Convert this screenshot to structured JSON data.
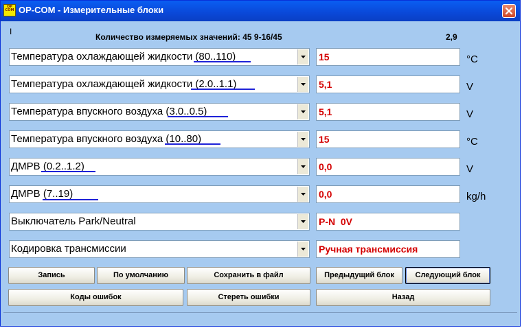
{
  "window": {
    "title": "OP-COM - Измерительные блоки",
    "icon_text": "OP COM",
    "icon_name": "opcom-app-icon",
    "close_icon": "close-icon"
  },
  "header": {
    "cursor_mark": "I",
    "count_text": "Количество измеряемых значений: 45   9-16/45",
    "elapsed": "2,9"
  },
  "rows": [
    {
      "label": "Температура охлаждающей жидкости (80..110)",
      "value": "15",
      "unit": "°C"
    },
    {
      "label": "Температура охлаждающей жидкости (2.0..1.1)",
      "value": "5,1",
      "unit": "V"
    },
    {
      "label": "Температура впускного воздуха (3.0..0.5)",
      "value": "5,1",
      "unit": "V"
    },
    {
      "label": "Температура впускного воздуха (10..80)",
      "value": "15",
      "unit": "°C"
    },
    {
      "label": "ДМРВ (0.2..1.2)",
      "value": "0,0",
      "unit": "V"
    },
    {
      "label": "ДМРВ (7..19)",
      "value": "0,0",
      "unit": "kg/h"
    },
    {
      "label": "Выключатель Park/Neutral",
      "value": "P-N  0V",
      "unit": ""
    },
    {
      "label": "Кодировка трансмиссии",
      "value": "Ручная трансмиссия",
      "unit": ""
    }
  ],
  "buttons": {
    "record": "Запись",
    "defaults": "По умолчанию",
    "save_file": "Сохранить в файл",
    "prev_block": "Предыдущий блок",
    "next_block": "Следующий блок",
    "error_codes": "Коды ошибок",
    "clear_errors": "Стереть ошибки",
    "back": "Назад"
  },
  "colors": {
    "value_text": "#d40000",
    "window_bg": "#a6caf0",
    "annotation_underline": "#1e22d8"
  }
}
